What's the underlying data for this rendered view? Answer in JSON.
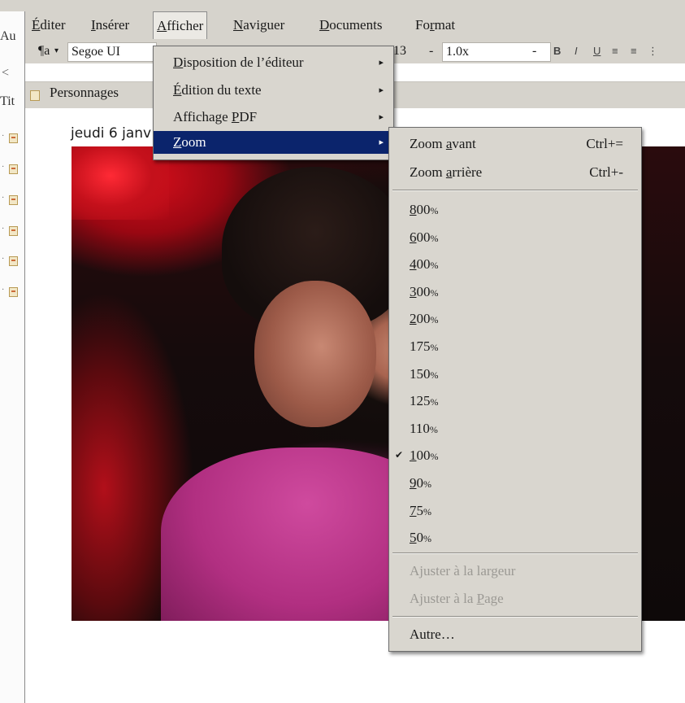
{
  "left_pane": {
    "fragments": [
      "Au",
      "Tit"
    ],
    "collapse_glyph": "<",
    "item_count": 6
  },
  "menubar": {
    "items": [
      {
        "label": "Éditer",
        "mnemonic": "É"
      },
      {
        "label": "Insérer",
        "mnemonic": "I"
      },
      {
        "label": "Afficher",
        "mnemonic": "A"
      },
      {
        "label": "Naviguer",
        "mnemonic": "N"
      },
      {
        "label": "Documents",
        "mnemonic": "D"
      },
      {
        "label": "Format",
        "mnemonic": "r"
      }
    ],
    "active": "Afficher"
  },
  "toolbar": {
    "para_style_icon": "paragraph-style-icon",
    "para_style_glyph": "¶a",
    "font_name": "Segoe UI",
    "font_size": "13",
    "line_spacing": "1.0x",
    "bold": "B",
    "italic": "I",
    "underline": "U",
    "align_left_icon": "align-left-icon",
    "align_center_icon": "align-center-icon",
    "dropdown_glyph": "-"
  },
  "panel": {
    "icon": "document-icon",
    "label": "Personnages"
  },
  "editor": {
    "date_text": "jeudi 6 janv"
  },
  "afficher_menu": {
    "items": [
      {
        "pre": "",
        "mn": "D",
        "post": "isposition de l’éditeur",
        "submenu": true
      },
      {
        "pre": "",
        "mn": "É",
        "post": "dition du texte",
        "submenu": true
      },
      {
        "pre": "Affichage ",
        "mn": "P",
        "post": "DF",
        "submenu": true
      },
      {
        "pre": "",
        "mn": "Z",
        "post": "oom",
        "submenu": true,
        "highlighted": true
      }
    ],
    "submenu_arrow": "▸"
  },
  "zoom_menu": {
    "zoom_in": {
      "pre": "Zoom ",
      "mn": "a",
      "post": "vant",
      "shortcut": "Ctrl+="
    },
    "zoom_out": {
      "pre": "Zoom ",
      "mn": "a",
      "post": "rrière",
      "shortcut": "Ctrl+-"
    },
    "levels": [
      {
        "mn": "8",
        "num": "00",
        "pct": "%",
        "checked": false
      },
      {
        "mn": "6",
        "num": "00",
        "pct": "%",
        "checked": false
      },
      {
        "mn": "4",
        "num": "00",
        "pct": "%",
        "checked": false
      },
      {
        "mn": "3",
        "num": "00",
        "pct": "%",
        "checked": false
      },
      {
        "mn": "2",
        "num": "00",
        "pct": "%",
        "checked": false
      },
      {
        "mn": "",
        "num": "175",
        "pct": "%",
        "checked": false
      },
      {
        "mn": "",
        "num": "150",
        "pct": "%",
        "checked": false
      },
      {
        "mn": "",
        "num": "125",
        "pct": "%",
        "checked": false
      },
      {
        "mn": "",
        "num": "110",
        "pct": "%",
        "checked": false
      },
      {
        "mn": "1",
        "num": "00",
        "pct": "%",
        "checked": true
      },
      {
        "mn": "9",
        "num": "0",
        "pct": "%",
        "checked": false
      },
      {
        "mn": "7",
        "num": "5",
        "pct": "%",
        "checked": false
      },
      {
        "mn": "5",
        "num": "0",
        "pct": "%",
        "checked": false
      }
    ],
    "check_glyph": "✔",
    "fit_width": {
      "pre": "Ajuster à la largeur",
      "mn": "",
      "post": "",
      "disabled": true
    },
    "fit_page": {
      "pre": "Ajuster à la ",
      "mn": "P",
      "post": "age",
      "disabled": true
    },
    "other": {
      "pre": "Autre…",
      "mn": "",
      "post": ""
    }
  },
  "colors": {
    "menu_bg": "#d9d6cf",
    "highlight": "#0b246c",
    "disabled_text": "#9b9994"
  }
}
